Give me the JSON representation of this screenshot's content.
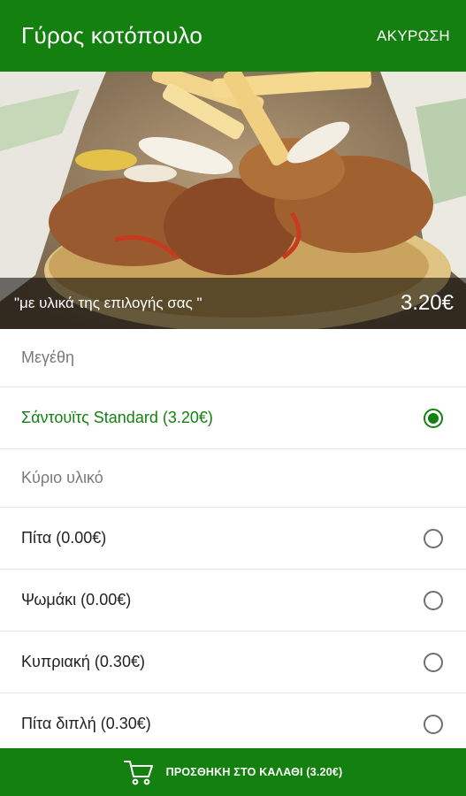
{
  "appbar": {
    "title": "Γύρος κοτόπουλο",
    "cancel_label": "ΑΚΥΡΩΣΗ"
  },
  "hero": {
    "caption": "\"με υλικά της επιλογής σας \"",
    "price": "3.20€"
  },
  "sizes": {
    "header": "Μεγέθη",
    "options": [
      {
        "label": "Σάντουϊτς Standard (3.20€)",
        "selected": true
      }
    ]
  },
  "main_ingredient": {
    "header": "Κύριο υλικό",
    "options": [
      {
        "label": "Πίτα (0.00€)",
        "selected": false
      },
      {
        "label": "Ψωμάκι (0.00€)",
        "selected": false
      },
      {
        "label": "Κυπριακή (0.30€)",
        "selected": false
      },
      {
        "label": "Πίτα διπλή (0.30€)",
        "selected": false
      }
    ]
  },
  "cart": {
    "icon": "cart-icon",
    "label": "ΠΡΟΣΘΗΚΗ ΣΤΟ ΚΑΛΑΘΙ (3.20€)"
  },
  "colors": {
    "brand_green": "#13800f"
  }
}
